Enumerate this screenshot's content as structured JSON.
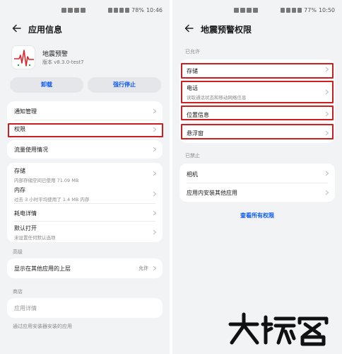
{
  "left": {
    "status": {
      "battery": "78%",
      "time": "10:46"
    },
    "title": "应用信息",
    "app": {
      "name": "地震预警",
      "version": "版本 v8.3.0-test7"
    },
    "buttons": {
      "uninstall": "卸载",
      "force_stop": "强行停止"
    },
    "card1": {
      "notification": "通知管理",
      "permissions": "权限"
    },
    "card2": {
      "data_usage": "流量使用情况"
    },
    "card3": {
      "storage": "存储",
      "storage_sub": "内部存储空间已使用 71.09 MB",
      "memory": "内存",
      "memory_sub": "过去 3 小时平均使用了 1.4 MB 内存",
      "battery": "耗电详情",
      "default_open": "默认打开",
      "default_open_sub": "未设置任何默认选项"
    },
    "advanced_label": "高级",
    "card4": {
      "overlay": "显示在其他应用的上层",
      "overlay_value": "允许"
    },
    "store_label": "商店",
    "card5": {
      "app_details": "应用详情"
    },
    "footer": "通过应用安装器安装的应用"
  },
  "right": {
    "status": {
      "battery": "77%",
      "time": "10:50"
    },
    "title": "地震预警权限",
    "allowed_label": "已允许",
    "allowed": {
      "storage": "存储",
      "phone": "电话",
      "phone_sub": "读取通话状态和移动网络信息",
      "location": "位置信息",
      "floating": "悬浮窗"
    },
    "denied_label": "已禁止",
    "denied": {
      "camera": "相机",
      "install_other": "应用内安装其他应用"
    },
    "view_all": "查看所有权限"
  },
  "colors": {
    "highlight": "#cc1f1f",
    "accent": "#0a59f7",
    "background": "#f1f3f5"
  }
}
